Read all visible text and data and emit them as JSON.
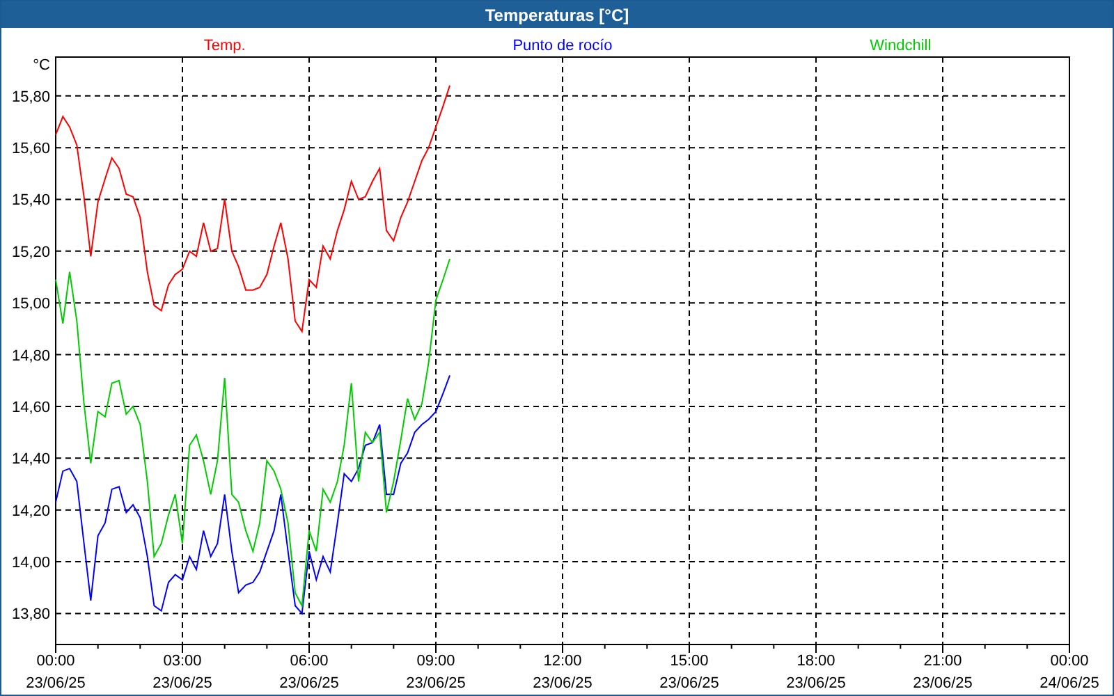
{
  "window": {
    "title": "Temperaturas [°C]"
  },
  "chart": {
    "chart_data": {
      "type": "line",
      "ylabel": "°C",
      "xlim": [
        0,
        24
      ],
      "ylim": [
        13.68,
        15.95
      ],
      "x": [
        0,
        0.17,
        0.33,
        0.5,
        0.67,
        0.83,
        1,
        1.17,
        1.33,
        1.5,
        1.67,
        1.83,
        2,
        2.17,
        2.33,
        2.5,
        2.67,
        2.83,
        3,
        3.17,
        3.33,
        3.5,
        3.67,
        3.83,
        4,
        4.17,
        4.33,
        4.5,
        4.67,
        4.83,
        5,
        5.17,
        5.33,
        5.5,
        5.67,
        5.83,
        6,
        6.17,
        6.33,
        6.5,
        6.67,
        6.83,
        7,
        7.17,
        7.33,
        7.5,
        7.67,
        7.83,
        8,
        8.17,
        8.33,
        8.5,
        8.67,
        8.83,
        9,
        9.17,
        9.33
      ],
      "series": [
        {
          "name": "Temp.",
          "color": "#ff0000",
          "values": [
            15.65,
            15.72,
            15.68,
            15.61,
            15.41,
            15.18,
            15.39,
            15.48,
            15.56,
            15.52,
            15.42,
            15.41,
            15.33,
            15.12,
            14.99,
            14.97,
            15.07,
            15.11,
            15.13,
            15.2,
            15.18,
            15.31,
            15.2,
            15.21,
            15.4,
            15.2,
            15.14,
            15.05,
            15.05,
            15.06,
            15.11,
            15.22,
            15.31,
            15.17,
            14.93,
            14.89,
            15.09,
            15.06,
            15.22,
            15.17,
            15.28,
            15.36,
            15.47,
            15.4,
            15.41,
            15.47,
            15.52,
            15.28,
            15.24,
            15.33,
            15.39,
            15.47,
            15.55,
            15.6,
            15.68,
            15.76,
            15.84
          ]
        },
        {
          "name": "Punto de rocío",
          "color": "#0000ff",
          "values": [
            14.23,
            14.35,
            14.36,
            14.31,
            14.07,
            13.85,
            14.1,
            14.15,
            14.28,
            14.29,
            14.19,
            14.22,
            14.17,
            14.02,
            13.83,
            13.81,
            13.92,
            13.95,
            13.93,
            14.02,
            13.97,
            14.12,
            14.02,
            14.07,
            14.26,
            14.04,
            13.88,
            13.91,
            13.92,
            13.96,
            14.04,
            14.12,
            14.26,
            14.04,
            13.83,
            13.8,
            14.04,
            13.93,
            14.02,
            13.96,
            14.15,
            14.34,
            14.31,
            14.36,
            14.45,
            14.46,
            14.53,
            14.26,
            14.26,
            14.38,
            14.42,
            14.5,
            14.53,
            14.55,
            14.58,
            14.65,
            14.72
          ]
        },
        {
          "name": "Windchill",
          "color": "#00cc00",
          "values": [
            15.09,
            14.92,
            15.12,
            14.93,
            14.61,
            14.38,
            14.58,
            14.56,
            14.69,
            14.7,
            14.57,
            14.6,
            14.53,
            14.31,
            14.02,
            14.07,
            14.18,
            14.26,
            14.07,
            14.45,
            14.49,
            14.39,
            14.26,
            14.39,
            14.71,
            14.26,
            14.23,
            14.12,
            14.04,
            14.15,
            14.39,
            14.35,
            14.28,
            14.15,
            13.88,
            13.83,
            14.12,
            14.04,
            14.28,
            14.23,
            14.31,
            14.45,
            14.69,
            14.31,
            14.5,
            14.46,
            14.5,
            14.19,
            14.31,
            14.47,
            14.63,
            14.55,
            14.61,
            14.77,
            15.01,
            15.09,
            15.17
          ]
        }
      ],
      "yticks": [
        {
          "value": 13.8,
          "label": "13,80"
        },
        {
          "value": 14,
          "label": "14,00"
        },
        {
          "value": 14.2,
          "label": "14,20"
        },
        {
          "value": 14.4,
          "label": "14,40"
        },
        {
          "value": 14.6,
          "label": "14,60"
        },
        {
          "value": 14.8,
          "label": "14,80"
        },
        {
          "value": 15,
          "label": "15,00"
        },
        {
          "value": 15.2,
          "label": "15,20"
        },
        {
          "value": 15.4,
          "label": "15,40"
        },
        {
          "value": 15.6,
          "label": "15,60"
        },
        {
          "value": 15.8,
          "label": "15,80"
        }
      ],
      "grid": true,
      "xticks": [
        {
          "value": 0,
          "label": "00:00"
        },
        {
          "value": 3,
          "label": "03:00"
        },
        {
          "value": 6,
          "label": "06:00"
        },
        {
          "value": 9,
          "label": "09:00"
        },
        {
          "value": 12,
          "label": "12:00"
        },
        {
          "value": 15,
          "label": "15:00"
        },
        {
          "value": 18,
          "label": "18:00"
        },
        {
          "value": 21,
          "label": "21:00"
        },
        {
          "value": 24,
          "label": "00:00"
        }
      ]
    },
    "x_tick_dates": [
      "23/06/25",
      "23/06/25",
      "23/06/25",
      "23/06/25",
      "23/06/25",
      "23/06/25",
      "23/06/25",
      "23/06/25",
      "24/06/25"
    ]
  }
}
